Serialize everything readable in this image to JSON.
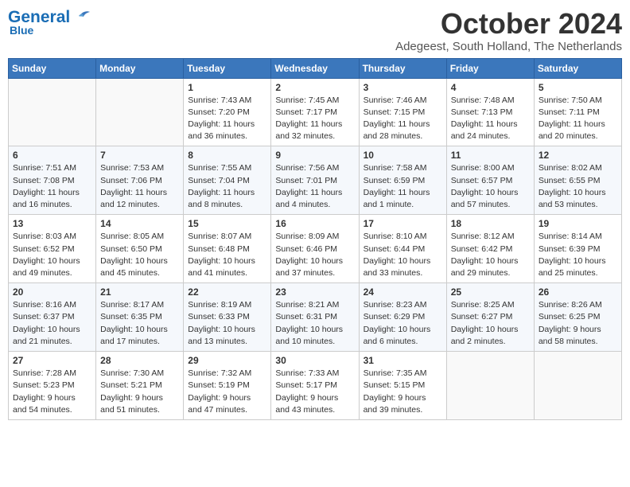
{
  "header": {
    "logo_general": "General",
    "logo_blue": "Blue",
    "month": "October 2024",
    "location": "Adegeest, South Holland, The Netherlands"
  },
  "weekdays": [
    "Sunday",
    "Monday",
    "Tuesday",
    "Wednesday",
    "Thursday",
    "Friday",
    "Saturday"
  ],
  "weeks": [
    [
      {
        "day": "",
        "sunrise": "",
        "sunset": "",
        "daylight": ""
      },
      {
        "day": "",
        "sunrise": "",
        "sunset": "",
        "daylight": ""
      },
      {
        "day": "1",
        "sunrise": "Sunrise: 7:43 AM",
        "sunset": "Sunset: 7:20 PM",
        "daylight": "Daylight: 11 hours and 36 minutes."
      },
      {
        "day": "2",
        "sunrise": "Sunrise: 7:45 AM",
        "sunset": "Sunset: 7:17 PM",
        "daylight": "Daylight: 11 hours and 32 minutes."
      },
      {
        "day": "3",
        "sunrise": "Sunrise: 7:46 AM",
        "sunset": "Sunset: 7:15 PM",
        "daylight": "Daylight: 11 hours and 28 minutes."
      },
      {
        "day": "4",
        "sunrise": "Sunrise: 7:48 AM",
        "sunset": "Sunset: 7:13 PM",
        "daylight": "Daylight: 11 hours and 24 minutes."
      },
      {
        "day": "5",
        "sunrise": "Sunrise: 7:50 AM",
        "sunset": "Sunset: 7:11 PM",
        "daylight": "Daylight: 11 hours and 20 minutes."
      }
    ],
    [
      {
        "day": "6",
        "sunrise": "Sunrise: 7:51 AM",
        "sunset": "Sunset: 7:08 PM",
        "daylight": "Daylight: 11 hours and 16 minutes."
      },
      {
        "day": "7",
        "sunrise": "Sunrise: 7:53 AM",
        "sunset": "Sunset: 7:06 PM",
        "daylight": "Daylight: 11 hours and 12 minutes."
      },
      {
        "day": "8",
        "sunrise": "Sunrise: 7:55 AM",
        "sunset": "Sunset: 7:04 PM",
        "daylight": "Daylight: 11 hours and 8 minutes."
      },
      {
        "day": "9",
        "sunrise": "Sunrise: 7:56 AM",
        "sunset": "Sunset: 7:01 PM",
        "daylight": "Daylight: 11 hours and 4 minutes."
      },
      {
        "day": "10",
        "sunrise": "Sunrise: 7:58 AM",
        "sunset": "Sunset: 6:59 PM",
        "daylight": "Daylight: 11 hours and 1 minute."
      },
      {
        "day": "11",
        "sunrise": "Sunrise: 8:00 AM",
        "sunset": "Sunset: 6:57 PM",
        "daylight": "Daylight: 10 hours and 57 minutes."
      },
      {
        "day": "12",
        "sunrise": "Sunrise: 8:02 AM",
        "sunset": "Sunset: 6:55 PM",
        "daylight": "Daylight: 10 hours and 53 minutes."
      }
    ],
    [
      {
        "day": "13",
        "sunrise": "Sunrise: 8:03 AM",
        "sunset": "Sunset: 6:52 PM",
        "daylight": "Daylight: 10 hours and 49 minutes."
      },
      {
        "day": "14",
        "sunrise": "Sunrise: 8:05 AM",
        "sunset": "Sunset: 6:50 PM",
        "daylight": "Daylight: 10 hours and 45 minutes."
      },
      {
        "day": "15",
        "sunrise": "Sunrise: 8:07 AM",
        "sunset": "Sunset: 6:48 PM",
        "daylight": "Daylight: 10 hours and 41 minutes."
      },
      {
        "day": "16",
        "sunrise": "Sunrise: 8:09 AM",
        "sunset": "Sunset: 6:46 PM",
        "daylight": "Daylight: 10 hours and 37 minutes."
      },
      {
        "day": "17",
        "sunrise": "Sunrise: 8:10 AM",
        "sunset": "Sunset: 6:44 PM",
        "daylight": "Daylight: 10 hours and 33 minutes."
      },
      {
        "day": "18",
        "sunrise": "Sunrise: 8:12 AM",
        "sunset": "Sunset: 6:42 PM",
        "daylight": "Daylight: 10 hours and 29 minutes."
      },
      {
        "day": "19",
        "sunrise": "Sunrise: 8:14 AM",
        "sunset": "Sunset: 6:39 PM",
        "daylight": "Daylight: 10 hours and 25 minutes."
      }
    ],
    [
      {
        "day": "20",
        "sunrise": "Sunrise: 8:16 AM",
        "sunset": "Sunset: 6:37 PM",
        "daylight": "Daylight: 10 hours and 21 minutes."
      },
      {
        "day": "21",
        "sunrise": "Sunrise: 8:17 AM",
        "sunset": "Sunset: 6:35 PM",
        "daylight": "Daylight: 10 hours and 17 minutes."
      },
      {
        "day": "22",
        "sunrise": "Sunrise: 8:19 AM",
        "sunset": "Sunset: 6:33 PM",
        "daylight": "Daylight: 10 hours and 13 minutes."
      },
      {
        "day": "23",
        "sunrise": "Sunrise: 8:21 AM",
        "sunset": "Sunset: 6:31 PM",
        "daylight": "Daylight: 10 hours and 10 minutes."
      },
      {
        "day": "24",
        "sunrise": "Sunrise: 8:23 AM",
        "sunset": "Sunset: 6:29 PM",
        "daylight": "Daylight: 10 hours and 6 minutes."
      },
      {
        "day": "25",
        "sunrise": "Sunrise: 8:25 AM",
        "sunset": "Sunset: 6:27 PM",
        "daylight": "Daylight: 10 hours and 2 minutes."
      },
      {
        "day": "26",
        "sunrise": "Sunrise: 8:26 AM",
        "sunset": "Sunset: 6:25 PM",
        "daylight": "Daylight: 9 hours and 58 minutes."
      }
    ],
    [
      {
        "day": "27",
        "sunrise": "Sunrise: 7:28 AM",
        "sunset": "Sunset: 5:23 PM",
        "daylight": "Daylight: 9 hours and 54 minutes."
      },
      {
        "day": "28",
        "sunrise": "Sunrise: 7:30 AM",
        "sunset": "Sunset: 5:21 PM",
        "daylight": "Daylight: 9 hours and 51 minutes."
      },
      {
        "day": "29",
        "sunrise": "Sunrise: 7:32 AM",
        "sunset": "Sunset: 5:19 PM",
        "daylight": "Daylight: 9 hours and 47 minutes."
      },
      {
        "day": "30",
        "sunrise": "Sunrise: 7:33 AM",
        "sunset": "Sunset: 5:17 PM",
        "daylight": "Daylight: 9 hours and 43 minutes."
      },
      {
        "day": "31",
        "sunrise": "Sunrise: 7:35 AM",
        "sunset": "Sunset: 5:15 PM",
        "daylight": "Daylight: 9 hours and 39 minutes."
      },
      {
        "day": "",
        "sunrise": "",
        "sunset": "",
        "daylight": ""
      },
      {
        "day": "",
        "sunrise": "",
        "sunset": "",
        "daylight": ""
      }
    ]
  ]
}
